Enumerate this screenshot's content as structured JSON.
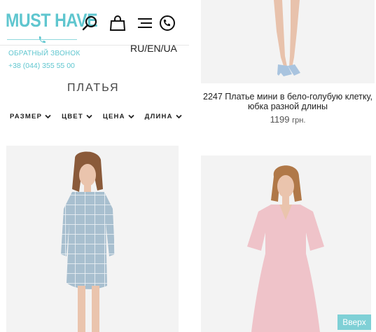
{
  "header": {
    "logo_text": "MUST HAVE",
    "callback_label": "ОБРАТНЫЙ ЗВОНОК",
    "phone": "+38 (044) 355 55 00",
    "languages": "RU/EN/UA",
    "icons": [
      "search-icon",
      "shopping-bag-icon",
      "menu-icon",
      "phone-icon"
    ],
    "accent_color": "#5fc6cf"
  },
  "page": {
    "title": "ПЛАТЬЯ"
  },
  "filters": [
    {
      "label": "РАЗМЕР"
    },
    {
      "label": "ЦВЕТ"
    },
    {
      "label": "ЦЕНА"
    },
    {
      "label": "ДЛИНА"
    }
  ],
  "products": [
    {
      "title": "2247 Платье мини в бело-голубую клетку, юбка разной длины",
      "price": "1199",
      "currency": "грн."
    }
  ],
  "scroll_top_label": "Вверх"
}
